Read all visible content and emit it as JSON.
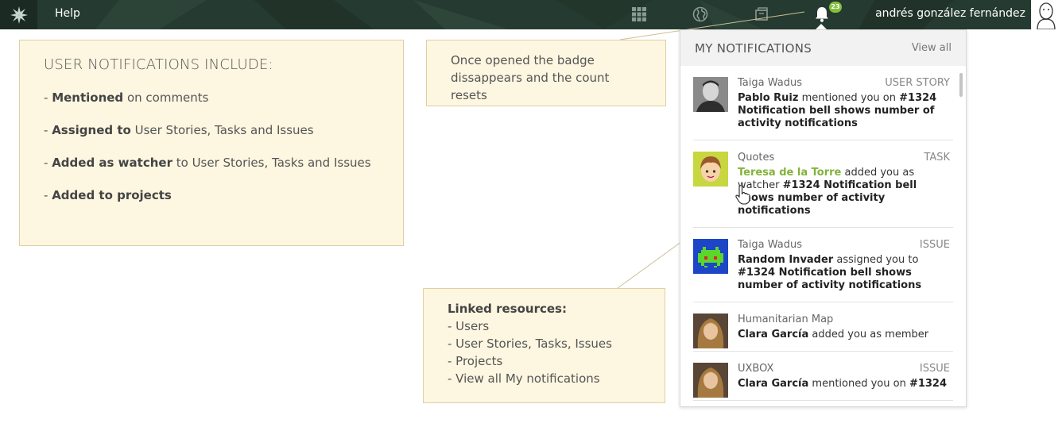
{
  "topbar": {
    "help_label": "Help",
    "notification_count": "23",
    "username": "andrés gonzález fernández",
    "icons": [
      "taiga-logo-icon",
      "apps-grid-icon",
      "globe-icon",
      "projects-icon",
      "bell-icon",
      "user-avatar"
    ]
  },
  "colors": {
    "topbar": "#253a30",
    "badge": "#83c03c",
    "note_bg": "#fdf6e0",
    "link_green": "#83b23a"
  },
  "note_includes": {
    "heading": "USER NOTIFICATIONS INCLUDE:",
    "items": [
      {
        "prefix": "- ",
        "bold": "Mentioned",
        "rest": " on comments"
      },
      {
        "prefix": "- ",
        "bold": "Assigned to",
        "rest": " User Stories, Tasks and Issues"
      },
      {
        "prefix": "- ",
        "bold": "Added as watcher",
        "rest": " to User Stories, Tasks and Issues"
      },
      {
        "prefix": "- ",
        "bold": "Added to projects",
        "rest": ""
      }
    ]
  },
  "note_badge": {
    "line1": "Once opened the badge",
    "line2": "dissappears and the count resets"
  },
  "note_linked": {
    "heading": "Linked resources:",
    "items": [
      "- Users",
      "- User Stories, Tasks, Issues",
      "- Projects",
      "- View all My notifications"
    ]
  },
  "panel": {
    "title": "MY NOTIFICATIONS",
    "view_all": "View all",
    "notifications": [
      {
        "project": "Taiga Wadus",
        "type": "USER STORY",
        "actor": "Pablo Ruiz",
        "action": " mentioned you on ",
        "ref": "#1324 Notification bell shows number of activity notifications",
        "avatar": "man-photo"
      },
      {
        "project": "Quotes",
        "type": "TASK",
        "actor": "Teresa de la Torre",
        "action": " added you as watcher ",
        "ref": "#1324 Notification bell shows number of activity notifications",
        "avatar": "cartoon-boy"
      },
      {
        "project": "Taiga Wadus",
        "type": "ISSUE",
        "actor": "Random Invader",
        "action": " assigned you to ",
        "ref": "#1324 Notification bell shows number of activity notifications",
        "avatar": "space-invader"
      },
      {
        "project": "Humanitarian Map",
        "type": "",
        "actor": "Clara García",
        "action": " added you as member",
        "ref": "",
        "avatar": "woman-photo"
      },
      {
        "project": "UXBOX",
        "type": "ISSUE",
        "actor": "Clara García",
        "action": " mentioned you on ",
        "ref": "#1324",
        "avatar": "woman-photo"
      }
    ]
  }
}
